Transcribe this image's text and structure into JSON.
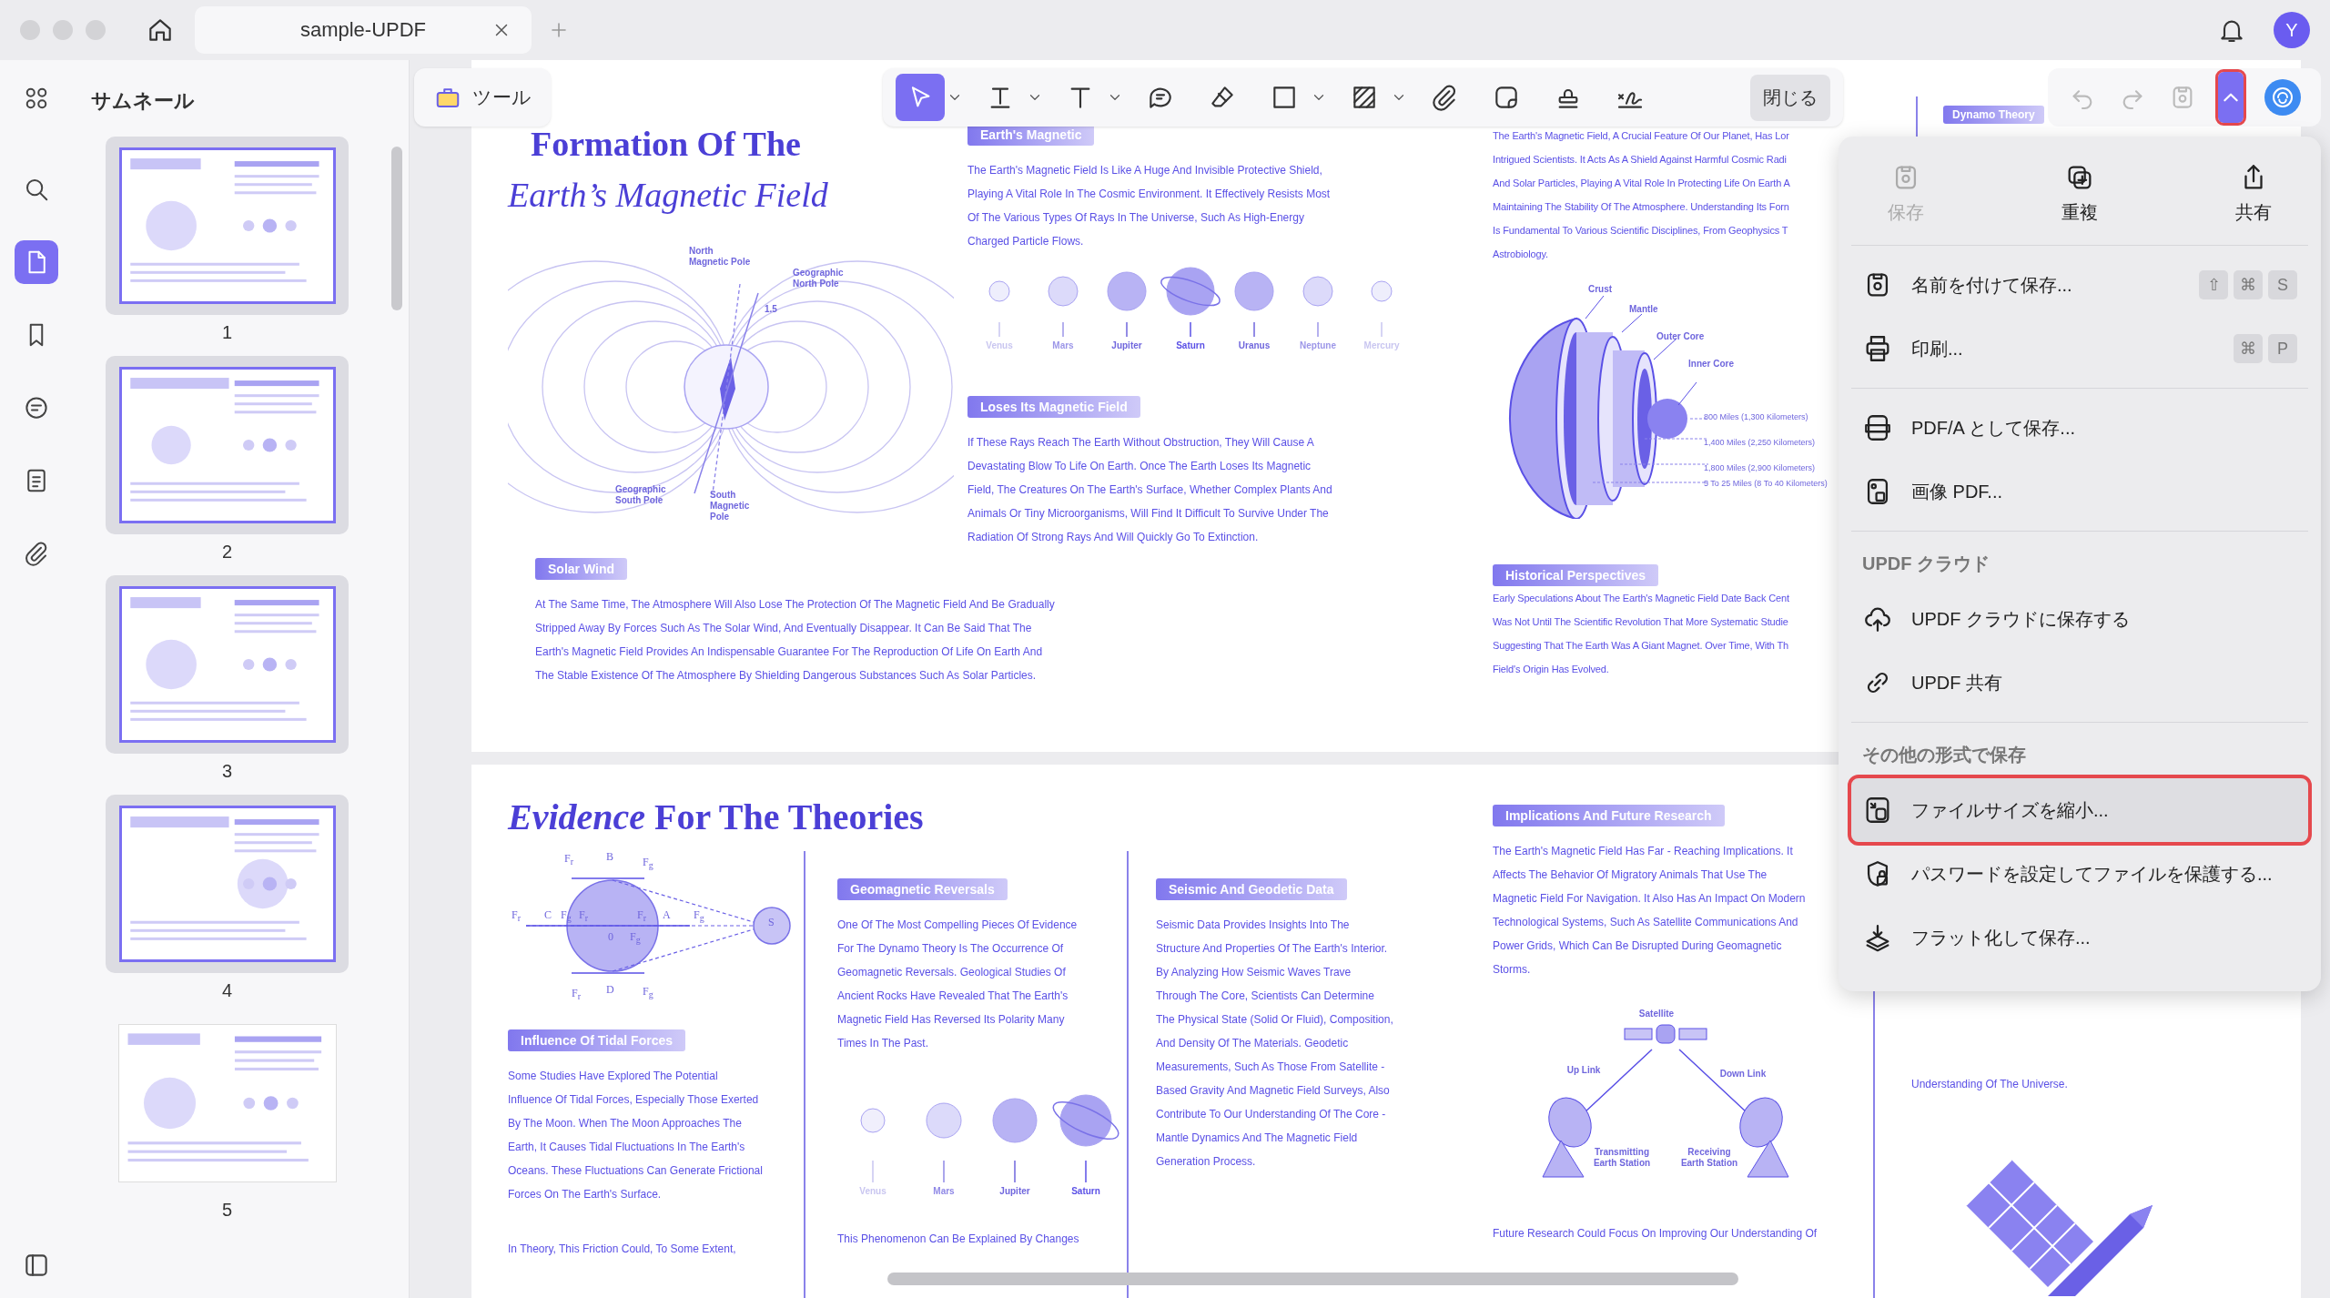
{
  "tab": {
    "title": "sample-UPDF"
  },
  "avatar": "Y",
  "rail": [
    {
      "selected": false
    },
    {
      "selected": false
    },
    {
      "selected": true
    },
    {
      "selected": false
    },
    {
      "selected": false
    },
    {
      "selected": false
    },
    {
      "selected": false
    }
  ],
  "thumbnails": {
    "title": "サムネール",
    "pages": [
      {
        "number": "1",
        "selected": true
      },
      {
        "number": "2",
        "selected": true
      },
      {
        "number": "3",
        "selected": true
      },
      {
        "number": "4",
        "selected": true
      },
      {
        "number": "5",
        "selected": false
      }
    ]
  },
  "toolbar": {
    "tools_button": "ツール",
    "tools": [
      {
        "selected": true,
        "dropdown": true
      },
      {
        "selected": false,
        "dropdown": true
      },
      {
        "selected": false,
        "dropdown": true
      },
      {
        "selected": false
      },
      {
        "selected": false
      },
      {
        "selected": false,
        "dropdown": true
      },
      {
        "selected": false,
        "dropdown": true
      },
      {
        "selected": false
      },
      {
        "selected": false
      },
      {
        "selected": false
      },
      {
        "selected": false
      }
    ],
    "close_button": "閉じる",
    "history": [
      {
        "disabled": true
      },
      {
        "disabled": true
      }
    ],
    "save_disabled": true,
    "menu_open": true
  },
  "page_1": {
    "title_line_1": "Formation Of The",
    "title_line_2": "Earth’s Magnetic Field",
    "magnetic_labels": [
      [
        "North",
        "Magnetic Pole"
      ],
      [
        "Geographic",
        "North Pole"
      ],
      [
        "1.5"
      ],
      [
        "Geographic",
        "South Pole"
      ],
      [
        "South",
        "Magnetic",
        "Pole"
      ]
    ],
    "intro": {
      "heading": "Earth's Magnetic",
      "lines": [
        "The Earth's Magnetic Field Is Like A Huge And Invisible Protective Shield,",
        "Playing A Vital Role In The Cosmic Environment. It Effectively Resists Most",
        "Of The Various Types Of Rays In The Universe, Such As High-Energy",
        "Charged Particle Flows."
      ]
    },
    "planets": [
      "Venus",
      "Mars",
      "Jupiter",
      "Saturn",
      "Uranus",
      "Neptune",
      "Mercury"
    ],
    "loses": {
      "heading": "Loses Its Magnetic Field",
      "lines": [
        "If These Rays Reach The Earth Without Obstruction, They Will Cause A",
        "Devastating Blow To Life On Earth. Once The Earth Loses Its Magnetic",
        "Field, The Creatures On The Earth's Surface, Whether Complex Plants And",
        "Animals Or Tiny Microorganisms, Will Find It Difficult To Survive Under The",
        "Radiation Of Strong Rays And Will Quickly Go To Extinction."
      ]
    },
    "solar_wind": {
      "heading": "Solar Wind",
      "lines": [
        "At The Same Time, The Atmosphere Will Also Lose The Protection Of The Magnetic Field And Be Gradually",
        "Stripped Away By Forces Such As The Solar Wind, And Eventually Disappear. It Can Be Said That The",
        "Earth's Magnetic Field Provides An Indispensable Guarantee For The Reproduction Of Life On Earth And",
        "The Stable Existence Of The Atmosphere By Shielding Dangerous Substances Such As Solar Particles."
      ]
    },
    "overview_lines": [
      "The Earth's Magnetic Field, A Crucial Feature Of Our Planet, Has Lor",
      "Intrigued Scientists. It Acts As A Shield Against Harmful Cosmic Radi",
      "And Solar Particles, Playing A Vital Role In Protecting Life On Earth A",
      "Maintaining The Stability Of The Atmosphere. Understanding Its Forn",
      "Is Fundamental To Various Scientific Disciplines, From Geophysics T",
      "Astrobiology."
    ],
    "layer_labels": [
      "Crust",
      "Mantle",
      "Outer Core",
      "Inner Core"
    ],
    "distance_labels": [
      "800 Miles (1,300 Kilometers)",
      "1,400 Miles (2,250 Kilometers)",
      "1,800 Miles (2,900 Kilometers)",
      "5 To 25 Miles (8 To 40 Kilometers)"
    ],
    "historical": {
      "heading": "Historical Perspectives",
      "lines": [
        "Early Speculations About The Earth's Magnetic Field Date Back Cent",
        "Was Not Until The Scientific Revolution That More Systematic Studie",
        "Suggesting That The Earth Was A Giant Magnet. Over Time, With Th",
        "Field's Origin Has Evolved."
      ]
    },
    "side_heading": "Dynamo Theory"
  },
  "page_2": {
    "title": "*Evidence* For The Theories",
    "tidal_labels": [
      "F$_{r}$",
      "B",
      "F$_{g}$",
      "F$_{r}$",
      "C",
      "F$_{g}$",
      "F$_{r}$",
      "F$_{r}$",
      "A",
      "F$_{g}$",
      "0",
      "F$_{g}$",
      "S",
      "F$_{r}$",
      "D",
      "F$_{g}$"
    ],
    "tidal": {
      "heading": "Influence Of Tidal Forces",
      "lines": [
        "Some Studies Have Explored The Potential",
        "Influence Of Tidal Forces, Especially Those Exerted",
        "By The Moon. When The Moon Approaches The",
        "Earth, It Causes Tidal Fluctuations In The Earth's",
        "Oceans. These Fluctuations Can Generate Frictional",
        "Forces On The Earth's Surface."
      ]
    },
    "tidal_more": "In Theory, This Friction Could, To Some Extent,",
    "reversals": {
      "heading": "Geomagnetic Reversals",
      "lines": [
        "One Of The Most Compelling Pieces Of Evidence",
        "For The Dynamo Theory Is The Occurrence Of",
        "Geomagnetic Reversals. Geological Studies Of",
        "Ancient Rocks Have Revealed That The Earth's",
        "Magnetic Field Has Reversed Its Polarity Many",
        "Times In The Past."
      ]
    },
    "planets": [
      "Venus",
      "Mars",
      "Jupiter",
      "Saturn"
    ],
    "reversals_more": "This Phenomenon Can Be Explained By Changes",
    "seismic": {
      "heading": "Seismic And Geodetic Data",
      "lines": [
        "Seismic Data Provides Insights Into The",
        "Structure And Properties Of The Earth's Interior.",
        "By Analyzing How Seismic Waves Trave",
        "Through The Core, Scientists Can Determine",
        "The Physical State (Solid Or Fluid), Composition,",
        "And Density Of The Materials. Geodetic",
        "Measurements, Such As Those From Satellite -",
        "Based Gravity And Magnetic Field Surveys, Also",
        "Contribute To Our Understanding Of The Core -",
        "Mantle Dynamics And The Magnetic Field",
        "Generation Process."
      ]
    },
    "implications": {
      "heading": "Implications And Future Research",
      "lines": [
        "The Earth's Magnetic Field Has Far - Reaching Implications. It",
        "Affects The Behavior Of Migratory Animals That Use The",
        "Magnetic Field For Navigation. It Also Has An Impact On Modern",
        "Technological Systems, Such As Satellite Communications And",
        "Power Grids, Which Can Be Disrupted During Geomagnetic",
        "Storms."
      ]
    },
    "link_labels": [
      [
        "Satellite"
      ],
      [
        "Up Link"
      ],
      [
        "Down Link"
      ],
      [
        "Transmitting",
        "Earth Station"
      ],
      [
        "Receiving",
        "Earth Station"
      ]
    ],
    "future": "Future Research Could Focus On Improving Our Understanding Of",
    "universe": "Understanding Of The Universe."
  },
  "menu": {
    "top_actions": [
      {
        "label": "保存",
        "disabled": true
      },
      {
        "label": "重複",
        "disabled": false
      },
      {
        "label": "共有",
        "disabled": false
      }
    ],
    "sections": [
      {
        "items": [
          {
            "label": "名前を付けて保存...",
            "keys": [
              "⇧",
              "⌘",
              "S"
            ],
            "selected": false
          },
          {
            "label": "印刷...",
            "keys": [
              "⌘",
              "P"
            ],
            "selected": false
          }
        ]
      },
      {
        "items": [
          {
            "label": "PDF/A として保存...",
            "selected": false
          },
          {
            "label": "画像 PDF...",
            "selected": false
          }
        ]
      },
      {
        "header": "UPDF クラウド",
        "items": [
          {
            "label": "UPDF クラウドに保存する",
            "selected": false
          },
          {
            "label": "UPDF 共有",
            "selected": false
          }
        ]
      },
      {
        "header": "その他の形式で保存",
        "items": [
          {
            "label": "ファイルサイズを縮小...",
            "selected": true
          },
          {
            "label": "パスワードを設定してファイルを保護する...",
            "selected": false
          },
          {
            "label": "フラット化して保存...",
            "selected": false
          }
        ]
      }
    ]
  }
}
